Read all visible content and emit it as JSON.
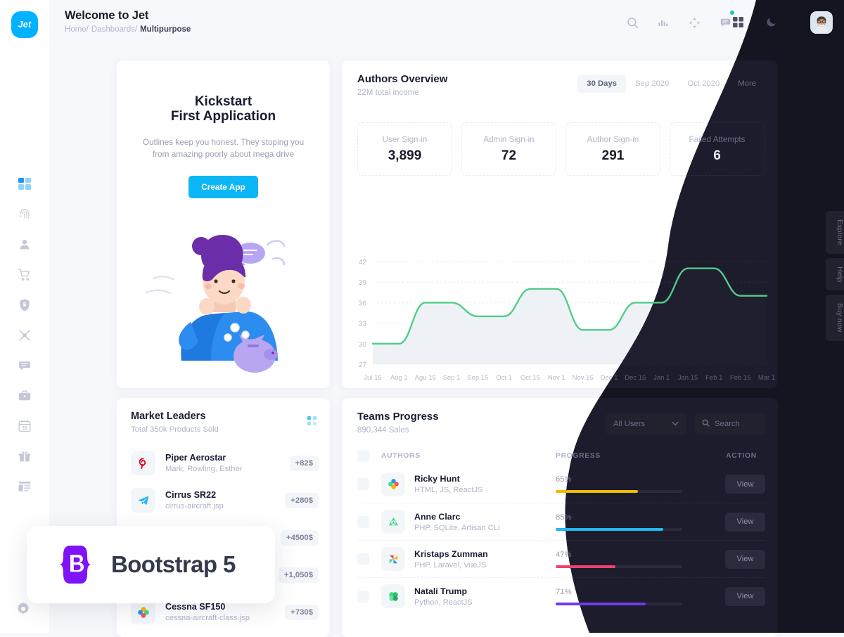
{
  "app": {
    "logo_text": "Jet"
  },
  "header": {
    "title": "Welcome to Jet",
    "breadcrumbs": [
      {
        "label": "Home/",
        "current": false
      },
      {
        "label": "Dashboards/",
        "current": false
      },
      {
        "label": "Multipurpose",
        "current": true
      }
    ],
    "icons": [
      "search-icon",
      "bar-chart-icon",
      "move-icon",
      "chat-icon",
      "grid-icon",
      "moon-icon"
    ],
    "notification_dot_color": "#1bc5bd"
  },
  "sidebar": {
    "items": [
      {
        "name": "dashboard",
        "icon": "grid-icon",
        "active": true
      },
      {
        "name": "fingerprint",
        "icon": "fingerprint-icon",
        "active": false
      },
      {
        "name": "user",
        "icon": "user-icon",
        "active": false
      },
      {
        "name": "cart",
        "icon": "cart-icon",
        "active": false
      },
      {
        "name": "security",
        "icon": "shield-lock-icon",
        "active": false
      },
      {
        "name": "drone",
        "icon": "drone-icon",
        "active": false
      },
      {
        "name": "chat",
        "icon": "chat-icon",
        "active": false
      },
      {
        "name": "briefcase",
        "icon": "briefcase-icon",
        "active": false
      },
      {
        "name": "calendar",
        "icon": "calendar-31-icon",
        "active": false
      },
      {
        "name": "gift",
        "icon": "gift-icon",
        "active": false
      },
      {
        "name": "layout",
        "icon": "layout-icon",
        "active": false
      }
    ],
    "settings_icon": "gear-icon"
  },
  "kickstart": {
    "title_line1": "Kickstart",
    "title_line2": "First Application",
    "description": "Outlines keep you honest. They stoping you from amazing poorly about mega drive",
    "button_label": "Create App",
    "button_color": "#0bb7f5"
  },
  "authors_overview": {
    "title": "Authors Overview",
    "subtitle": "22M total income",
    "tabs": [
      {
        "label": "30 Days",
        "active": true
      },
      {
        "label": "Sep 2020",
        "active": false
      },
      {
        "label": "Oct 2020",
        "active": false
      },
      {
        "label": "More",
        "active": false
      }
    ],
    "stats": [
      {
        "label": "User Sign-in",
        "value": "3,899"
      },
      {
        "label": "Admin Sign-in",
        "value": "72"
      },
      {
        "label": "Author Sign-in",
        "value": "291"
      },
      {
        "label": "Failed Attempts",
        "value": "6"
      }
    ]
  },
  "chart_data": {
    "type": "area",
    "title": "Authors Overview",
    "xlabel": "",
    "ylabel": "",
    "ylim": [
      27,
      42
    ],
    "yticks": [
      27,
      30,
      33,
      36,
      39,
      42
    ],
    "grid": true,
    "legend": "none",
    "line_color": "#50cd89",
    "fill_color": "#eef2f6",
    "categories": [
      "Jul 15",
      "Aug 1",
      "Agu 15",
      "Sep 1",
      "Sep 15",
      "Oct 1",
      "Oct 15",
      "Nov 1",
      "Nov 15",
      "Dec 1",
      "Dec 15",
      "Jan 1",
      "Jan 15",
      "Feb 1",
      "Feb 15",
      "Mar 1"
    ],
    "values": [
      30,
      30,
      36,
      36,
      34,
      34,
      38,
      38,
      32,
      32,
      36,
      36,
      41,
      41,
      37,
      37
    ]
  },
  "market_leaders": {
    "title": "Market Leaders",
    "subtitle": "Total 350k Products Sold",
    "menu_icon": "dots-grid-icon",
    "rows": [
      {
        "name": "Piper Aerostar",
        "desc": "Mark, Rowling, Esther",
        "badge": "+82$",
        "icon": "pinterest-icon"
      },
      {
        "name": "Cirrus SR22",
        "desc": "cirrus-aircraft.jsp",
        "badge": "+280$",
        "icon": "telegram-icon"
      },
      {
        "name": "",
        "desc": "",
        "badge": "+4500$",
        "icon": "hidden-icon"
      },
      {
        "name": "",
        "desc": "",
        "badge": "+1,050$",
        "icon": "hidden-icon"
      },
      {
        "name": "Cessna SF150",
        "desc": "cessna-aircraft-class.jsp",
        "badge": "+730$",
        "icon": "flower-icon"
      }
    ]
  },
  "teams_progress": {
    "title": "Teams Progress",
    "subtitle": "890,344 Sales",
    "filter_value": "All Users",
    "search_placeholder": "Search",
    "columns": [
      "AUTHORS",
      "PROGRESS",
      "ACTION"
    ],
    "action_label": "View",
    "rows": [
      {
        "name": "Ricky Hunt",
        "stack": "HTML, JS, ReactJS",
        "percent": "65%",
        "pct": 65,
        "color": "#f1bc00",
        "icon": "flower-icon"
      },
      {
        "name": "Anne Clarc",
        "stack": "PHP, SQLite, Artisan CLI",
        "percent": "85%",
        "pct": 85,
        "color": "#22b7f0",
        "icon": "drive-icon"
      },
      {
        "name": "Kristaps Zumman",
        "stack": "PHP, Laravel, VueJS",
        "percent": "47%",
        "pct": 47,
        "color": "#f1416c",
        "icon": "pinwheel-icon"
      },
      {
        "name": "Natali Trump",
        "stack": "Python, ReactJS",
        "percent": "71%",
        "pct": 71,
        "color": "#7239ea",
        "icon": "clover-icon"
      }
    ]
  },
  "rail_tabs": [
    {
      "label": "Explore"
    },
    {
      "label": "Help"
    },
    {
      "label": "Buy now"
    }
  ],
  "bootstrap_badge": {
    "label": "Bootstrap 5",
    "mark_color": "#7e13f8",
    "mark_letter": "B"
  }
}
